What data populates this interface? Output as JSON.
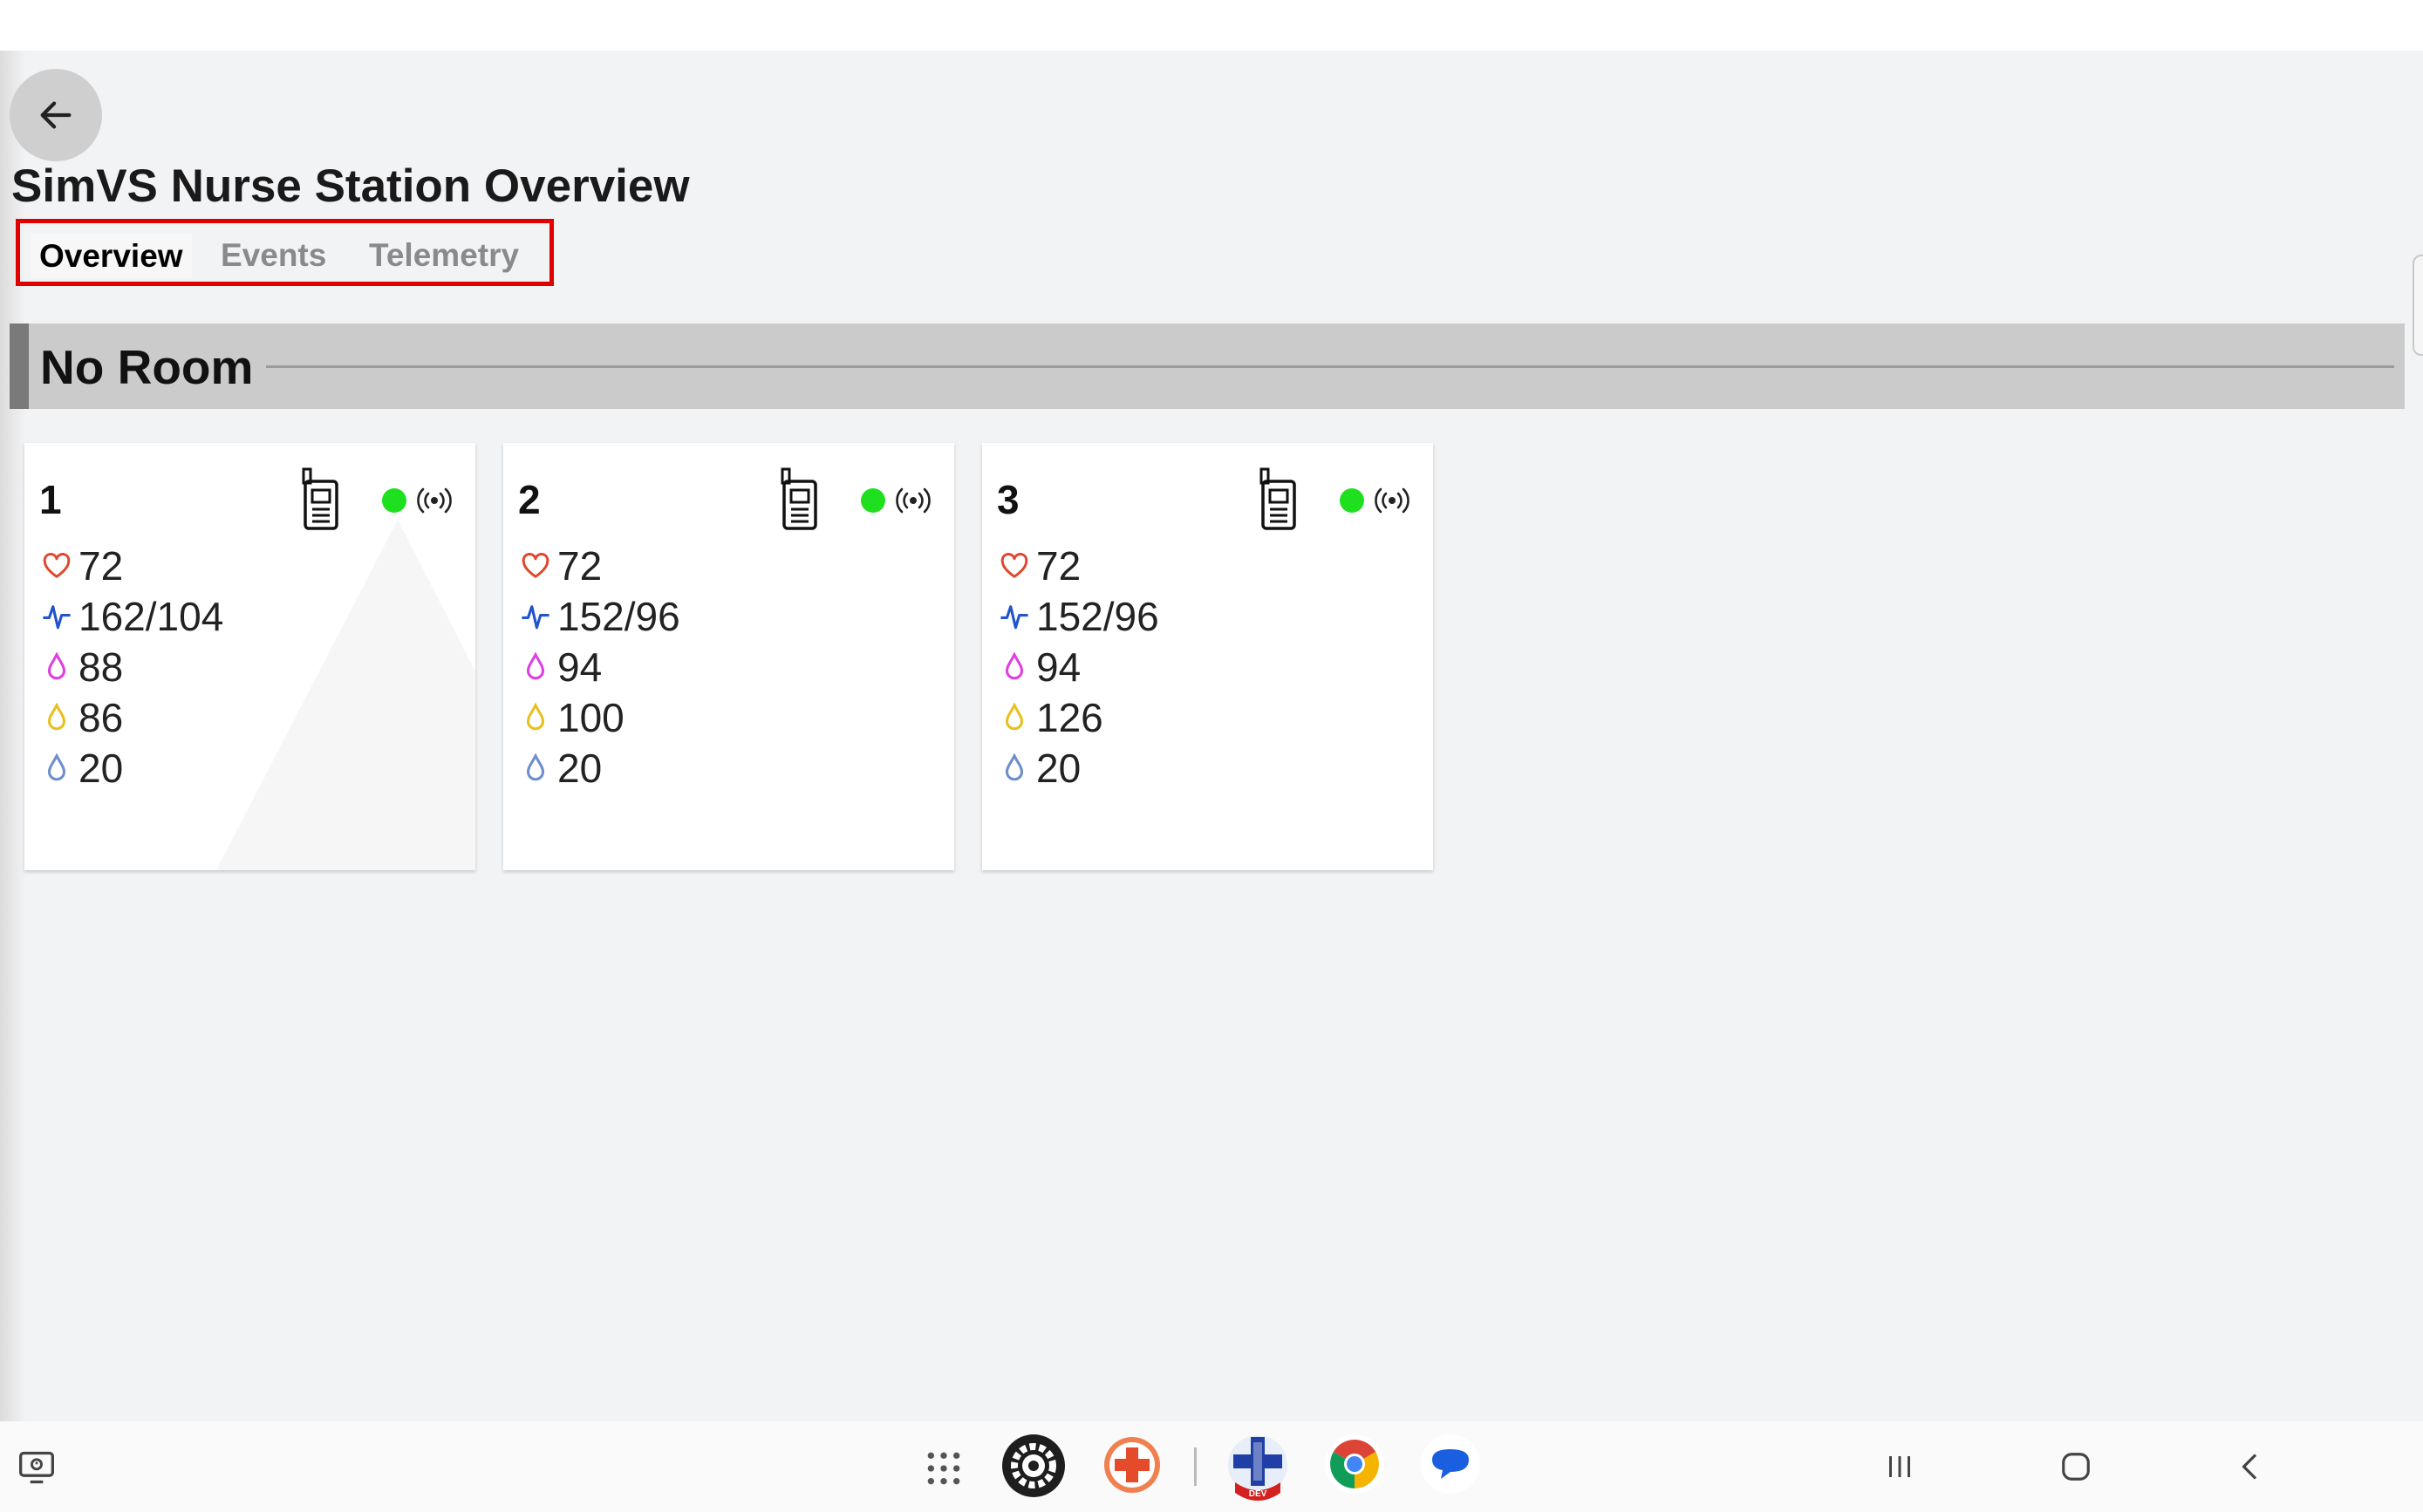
{
  "header": {
    "title": "SimVS Nurse Station Overview",
    "back_icon": "arrow-left-icon"
  },
  "tabs": [
    {
      "label": "Overview",
      "active": true
    },
    {
      "label": "Events",
      "active": false
    },
    {
      "label": "Telemetry",
      "active": false
    }
  ],
  "room": {
    "title": "No Room"
  },
  "colors": {
    "heart": "#e0482e",
    "blood_pressure": "#2255cc",
    "drop_magenta": "#e040e0",
    "drop_yellow": "#e8c020",
    "drop_blue": "#6e8fcc",
    "status_online": "#1ee01e",
    "highlight_box": "#e00000"
  },
  "beds": [
    {
      "number": "1",
      "device_icon": "handheld-device-icon",
      "status_icon": "status-dot-icon",
      "signal_icon": "broadcast-signal-icon",
      "vitals": {
        "heart_rate": "72",
        "blood_pressure": "162/104",
        "drop_magenta": "88",
        "drop_yellow": "86",
        "drop_blue": "20"
      }
    },
    {
      "number": "2",
      "device_icon": "handheld-device-icon",
      "status_icon": "status-dot-icon",
      "signal_icon": "broadcast-signal-icon",
      "vitals": {
        "heart_rate": "72",
        "blood_pressure": "152/96",
        "drop_magenta": "94",
        "drop_yellow": "100",
        "drop_blue": "20"
      }
    },
    {
      "number": "3",
      "device_icon": "handheld-device-icon",
      "status_icon": "status-dot-icon",
      "signal_icon": "broadcast-signal-icon",
      "vitals": {
        "heart_rate": "72",
        "blood_pressure": "152/96",
        "drop_magenta": "94",
        "drop_yellow": "126",
        "drop_blue": "20"
      }
    }
  ],
  "taskbar": {
    "left_icon": "screen-recorder-icon",
    "apps": [
      "app-grid-icon",
      "settings-app-icon",
      "medical-cross-app-icon",
      "simvs-dev-app-icon",
      "chrome-app-icon",
      "messages-app-icon"
    ],
    "dev_badge": "DEV",
    "nav": [
      "recents-icon",
      "home-icon",
      "back-icon"
    ]
  }
}
